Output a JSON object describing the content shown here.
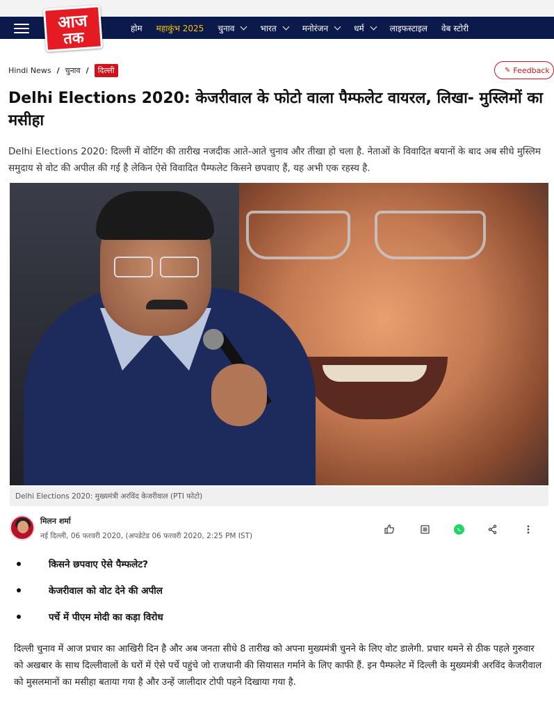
{
  "nav": {
    "logo_line1": "आज",
    "logo_line2": "तक",
    "items": [
      {
        "label": "होम",
        "has_dropdown": false
      },
      {
        "label": "महाकुंभ 2025",
        "has_dropdown": false,
        "highlight": true
      },
      {
        "label": "चुनाव",
        "has_dropdown": true
      },
      {
        "label": "भारत",
        "has_dropdown": true
      },
      {
        "label": "मनोरंजन",
        "has_dropdown": true
      },
      {
        "label": "धर्म",
        "has_dropdown": true
      },
      {
        "label": "लाइफस्टाइल",
        "has_dropdown": false
      },
      {
        "label": "वेब स्टोरी",
        "has_dropdown": false
      }
    ]
  },
  "breadcrumb": [
    "Hindi News",
    "चुनाव",
    "दिल्ली"
  ],
  "feedback_label": "Feedback",
  "article": {
    "headline": "Delhi Elections 2020: केजरीवाल के फोटो वाला पैम्फलेट वायरल, लिखा- मुस्लिमों का मसीहा",
    "summary": "Delhi Elections 2020: दिल्ली में वोटिंग की तारीख नजदीक आते-आते चुनाव और तीखा हो चला है. नेताओं के विवादित बयानों के बाद अब सीधे मुस्लिम समुदाय से वोट की अपील की गई है लेकिन ऐसे विवादित पैम्फलेट किसने छपवाए हैं, यह अभी एक रहस्य है.",
    "image_caption": "Delhi Elections 2020: मुख्यमंत्री अरविंद केजरीवाल (PTI फोटो)",
    "author": "मिलन शर्मा",
    "meta": "नई दिल्ली, 06 फरवरी 2020, (अपडेटेड 06 फरवरी 2020, 2:25 PM IST)",
    "highlights": [
      "किसने छपवाए ऐसे पैम्फलेट?",
      "केजरीवाल को वोट देने की अपील",
      "पर्चे में पीएम मोदी का कड़ा विरोध"
    ],
    "body": "दिल्ली चुनाव में आज प्रचार का आखिरी दिन है और अब जनता सीधे 8 तारीख को अपना मुख्यमंत्री चुनने के लिए वोट डालेगी. प्रचार थमने से ठीक पहले गुरुवार को अखबार के साथ दिल्लीवालों के घरों में ऐसे पर्चे पहुंचे जो राजधानी की सियासत गर्माने के लिए काफी हैं. इन पैम्फलेट में दिल्ली के मुख्यमंत्री अरविंद केजरीवाल को मुसलमानों का मसीहा बताया गया है और उन्हें जालीदार टोपी पहने दिखाया गया है."
  },
  "colors": {
    "nav_bg": "#0b1a4a",
    "brand_red": "#e41b23",
    "highlight_yellow": "#f7c600",
    "whatsapp_green": "#25d366"
  },
  "icons": [
    "hamburger-icon",
    "chevron-down-icon",
    "pen-icon",
    "like-icon",
    "comment-icon",
    "whatsapp-icon",
    "share-icon",
    "more-icon"
  ]
}
